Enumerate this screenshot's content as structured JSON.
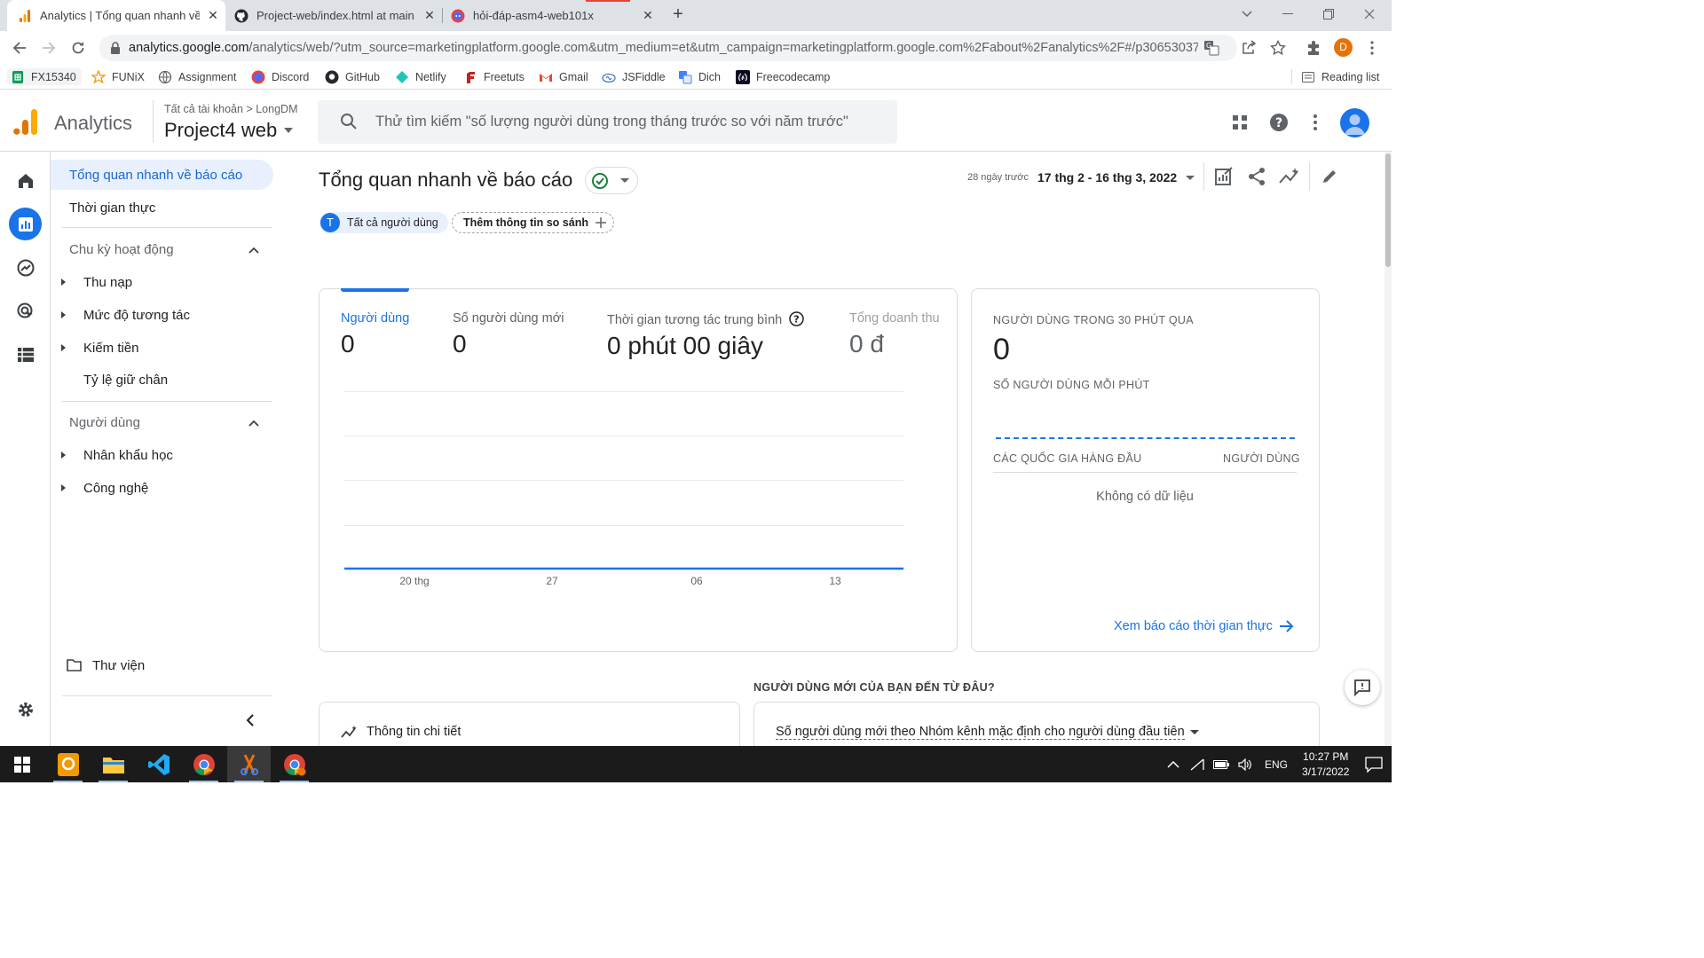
{
  "browser": {
    "tabs": [
      {
        "title": "Analytics | Tổng quan nhanh về b",
        "active": true
      },
      {
        "title": "Project-web/index.html at main ·",
        "active": false
      },
      {
        "title": "hỏi-đáp-asm4-web101x",
        "active": false
      }
    ],
    "url_host": "analytics.google.com",
    "url_rest": "/analytics/web/?utm_source=marketingplatform.google.com&utm_medium=et&utm_campaign=marketingplatform.google.com%2Fabout%2Fanalytics%2F#/p30653037...",
    "profile_initial": "D"
  },
  "bookmarks": [
    {
      "label": "FX15340",
      "icon": "sheets-icon"
    },
    {
      "label": "FUNiX",
      "icon": "funix-icon"
    },
    {
      "label": "Assignment",
      "icon": "globe-icon"
    },
    {
      "label": "Discord",
      "icon": "discord-icon"
    },
    {
      "label": "GitHub",
      "icon": "github-icon"
    },
    {
      "label": "Netlify",
      "icon": "netlify-icon"
    },
    {
      "label": "Freetuts",
      "icon": "freetuts-icon"
    },
    {
      "label": "Gmail",
      "icon": "gmail-icon"
    },
    {
      "label": "JSFiddle",
      "icon": "jsfiddle-icon"
    },
    {
      "label": "Dich",
      "icon": "translate-icon"
    },
    {
      "label": "Freecodecamp",
      "icon": "freecodecamp-icon"
    }
  ],
  "reading_list": "Reading list",
  "ga": {
    "brand": "Analytics",
    "crumb_all": "Tất cả tài khoản",
    "crumb_sep": ">",
    "crumb_account": "LongDM",
    "property": "Project4 web",
    "search_placeholder": "Thử tìm kiếm \"số lượng người dùng trong tháng trước so với năm trước\""
  },
  "nav": {
    "overview": "Tổng quan nhanh về báo cáo",
    "realtime": "Thời gian thực",
    "section_lifecycle": "Chu kỳ hoạt động",
    "acquisition": "Thu nạp",
    "engagement": "Mức độ tương tác",
    "monetization": "Kiếm tiền",
    "retention": "Tỷ lệ giữ chân",
    "section_user": "Người dùng",
    "demographics": "Nhân khẩu học",
    "tech": "Công nghệ",
    "library": "Thư viện"
  },
  "main": {
    "title": "Tổng quan nhanh về báo cáo",
    "date_prefix": "28 ngày trước",
    "date_range": "17 thg 2 - 16 thg 3, 2022",
    "chip_all_users_letter": "T",
    "chip_all_users": "Tất cả người dùng",
    "chip_add_compare": "Thêm thông tin so sánh",
    "metrics": [
      {
        "label": "Người dùng",
        "value": "0"
      },
      {
        "label": "Số người dùng mới",
        "value": "0"
      },
      {
        "label": "Thời gian tương tác trung bình",
        "value": "0 phút 00 giây"
      },
      {
        "label": "Tổng doanh thu",
        "value": "0 đ"
      }
    ],
    "new_users_heading": "NGƯỜI DÙNG MỚI CỦA BẠN ĐẾN TỪ ĐÂU?",
    "insights": "Thông tin chi tiết",
    "new_users_dim": "Số người dùng mới theo Nhóm kênh mặc định cho người dùng đầu tiên"
  },
  "chart_data": {
    "type": "line",
    "x": [
      "20 thg",
      "27",
      "06",
      "13"
    ],
    "series": [
      {
        "values": [
          0,
          0,
          0,
          0
        ]
      }
    ],
    "ylim": [
      0,
      4
    ],
    "grid": true,
    "accent": "#1a73e8"
  },
  "realtime": {
    "heading": "NGƯỜI DÙNG TRONG 30 PHÚT QUA",
    "value": "0",
    "per_minute": "SỐ NGƯỜI DÙNG MỖI PHÚT",
    "col_country": "CÁC QUỐC GIA HÀNG ĐẦU",
    "col_users": "NGƯỜI DÙNG",
    "empty": "Không có dữ liệu",
    "link": "Xem báo cáo thời gian thực"
  },
  "taskbar": {
    "lang": "ENG",
    "time": "10:27 PM",
    "date": "3/17/2022"
  }
}
